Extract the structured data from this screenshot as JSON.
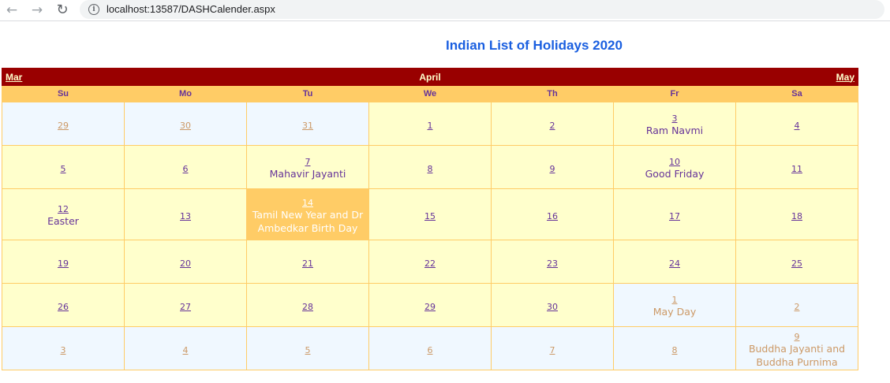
{
  "browser": {
    "url": "localhost:13587/DASHCalender.aspx",
    "back_icon": "←",
    "forward_icon": "→",
    "reload_icon": "↻",
    "info_icon": "i"
  },
  "page": {
    "title": "Indian List of Holidays 2020"
  },
  "calendar": {
    "month": "April",
    "prev_month": "Mar",
    "next_month": "May",
    "day_names": [
      "Su",
      "Mo",
      "Tu",
      "We",
      "Th",
      "Fr",
      "Sa"
    ],
    "weeks": [
      [
        {
          "day": "29",
          "other": true
        },
        {
          "day": "30",
          "other": true
        },
        {
          "day": "31",
          "other": true
        },
        {
          "day": "1"
        },
        {
          "day": "2"
        },
        {
          "day": "3",
          "holiday": "Ram Navmi"
        },
        {
          "day": "4"
        }
      ],
      [
        {
          "day": "5"
        },
        {
          "day": "6"
        },
        {
          "day": "7",
          "holiday": "Mahavir Jayanti"
        },
        {
          "day": "8"
        },
        {
          "day": "9"
        },
        {
          "day": "10",
          "holiday": "Good Friday"
        },
        {
          "day": "11"
        }
      ],
      [
        {
          "day": "12",
          "holiday": "Easter"
        },
        {
          "day": "13"
        },
        {
          "day": "14",
          "holiday": "Tamil New Year and Dr Ambedkar Birth Day",
          "selected": true
        },
        {
          "day": "15"
        },
        {
          "day": "16"
        },
        {
          "day": "17"
        },
        {
          "day": "18"
        }
      ],
      [
        {
          "day": "19"
        },
        {
          "day": "20"
        },
        {
          "day": "21"
        },
        {
          "day": "22"
        },
        {
          "day": "23"
        },
        {
          "day": "24"
        },
        {
          "day": "25"
        }
      ],
      [
        {
          "day": "26"
        },
        {
          "day": "27"
        },
        {
          "day": "28"
        },
        {
          "day": "29"
        },
        {
          "day": "30"
        },
        {
          "day": "1",
          "holiday": "May Day",
          "other": true
        },
        {
          "day": "2",
          "other": true
        }
      ],
      [
        {
          "day": "3",
          "other": true
        },
        {
          "day": "4",
          "other": true
        },
        {
          "day": "5",
          "other": true
        },
        {
          "day": "6",
          "other": true
        },
        {
          "day": "7",
          "other": true
        },
        {
          "day": "8",
          "other": true
        },
        {
          "day": "9",
          "holiday": "Buddha Jayanti and Buddha Purnima",
          "other": true
        }
      ]
    ]
  },
  "colors": {
    "title_bar": "#990000",
    "day_header": "#ffcc66",
    "current_month_cell": "#ffffcc",
    "other_month_cell": "#f0f8ff",
    "selected_cell": "#ffcc66",
    "page_title": "#1a5fe0"
  }
}
